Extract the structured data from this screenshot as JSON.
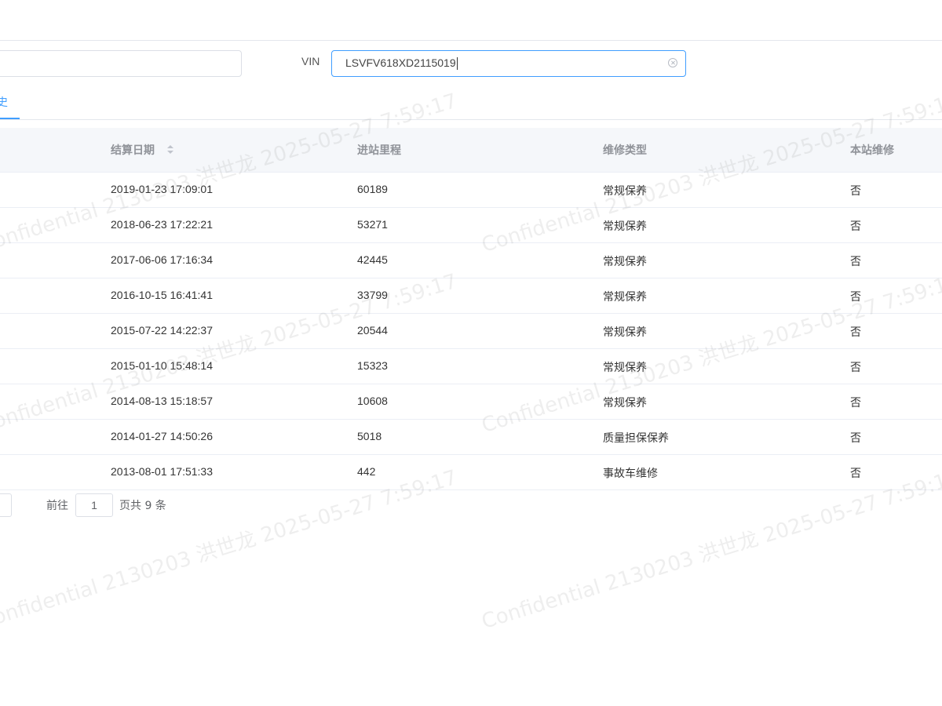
{
  "filters": {
    "vin_label": "VIN",
    "vin_value": "LSVFV618XD2115019"
  },
  "tabs": {
    "active_label": "史"
  },
  "table": {
    "columns": {
      "settle_date": "结算日期",
      "mileage": "进站里程",
      "repair_type": "维修类型",
      "local_repair": "本站维修"
    },
    "rows": [
      {
        "date": "2019-01-23 17:09:01",
        "mileage": "60189",
        "type": "常规保养",
        "local": "否"
      },
      {
        "date": "2018-06-23 17:22:21",
        "mileage": "53271",
        "type": "常规保养",
        "local": "否"
      },
      {
        "date": "2017-06-06 17:16:34",
        "mileage": "42445",
        "type": "常规保养",
        "local": "否"
      },
      {
        "date": "2016-10-15 16:41:41",
        "mileage": "33799",
        "type": "常规保养",
        "local": "否"
      },
      {
        "date": "2015-07-22 14:22:37",
        "mileage": "20544",
        "type": "常规保养",
        "local": "否"
      },
      {
        "date": "2015-01-10 15:48:14",
        "mileage": "15323",
        "type": "常规保养",
        "local": "否"
      },
      {
        "date": "2014-08-13 15:18:57",
        "mileage": "10608",
        "type": "常规保养",
        "local": "否"
      },
      {
        "date": "2014-01-27 14:50:26",
        "mileage": "5018",
        "type": "质量担保保养",
        "local": "否"
      },
      {
        "date": "2013-08-01 17:51:33",
        "mileage": "442",
        "type": "事故车维修",
        "local": "否"
      }
    ]
  },
  "pagination": {
    "goto_label": "前往",
    "page_value": "1",
    "total_label": "页共 9 条"
  },
  "watermark": {
    "text_a": "Confidential 2130203 洪世龙 2025-05-27 7:59:17"
  },
  "colors": {
    "accent": "#409eff",
    "border": "#dcdfe6",
    "header_bg": "#f5f7fa"
  }
}
